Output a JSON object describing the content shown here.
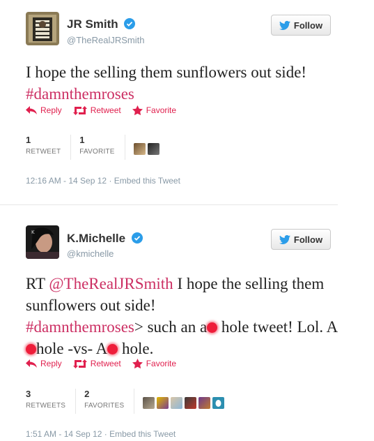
{
  "tweets": [
    {
      "name": "JR Smith",
      "handle": "@TheRealJRSmith",
      "follow_label": "Follow",
      "text_parts": {
        "line1": "I hope the selling them sunflowers out side!",
        "hashtag": "#damnthemroses"
      },
      "actions": {
        "reply": "Reply",
        "retweet": "Retweet",
        "favorite": "Favorite"
      },
      "stats": {
        "retweets_count": "1",
        "retweets_label": "RETWEET",
        "favorites_count": "1",
        "favorites_label": "FAVORITE"
      },
      "timestamp": "12:16 AM - 14 Sep 12",
      "embed_label": "Embed this Tweet"
    },
    {
      "name": "K.Michelle",
      "handle": "@kmichelle",
      "follow_label": "Follow",
      "text_parts": {
        "rt": "RT ",
        "mention": "@TheRealJRSmith",
        "after_mention": " I hope the selling them sunflowers out side!",
        "hashtag": "#damnthemroses",
        "after_hashtag_1": "> such an a",
        "after_hashtag_2": " hole tweet! Lol. A",
        "after_hashtag_3": "hole -vs- A",
        "after_hashtag_4": " hole."
      },
      "actions": {
        "reply": "Reply",
        "retweet": "Retweet",
        "favorite": "Favorite"
      },
      "stats": {
        "retweets_count": "3",
        "retweets_label": "RETWEETS",
        "favorites_count": "2",
        "favorites_label": "FAVORITES"
      },
      "timestamp": "1:51 AM - 14 Sep 12",
      "embed_label": "Embed this Tweet"
    }
  ],
  "colors": {
    "accent": "#e0204e",
    "hashtag": "#cc2f63",
    "verified": "#2b9de9",
    "follow_bird": "#2b9de9",
    "meta": "#8899a6"
  },
  "icons": [
    "verified-badge-icon",
    "twitter-bird-icon",
    "reply-arrow-icon",
    "retweet-icon",
    "star-icon",
    "egg-avatar-icon"
  ]
}
